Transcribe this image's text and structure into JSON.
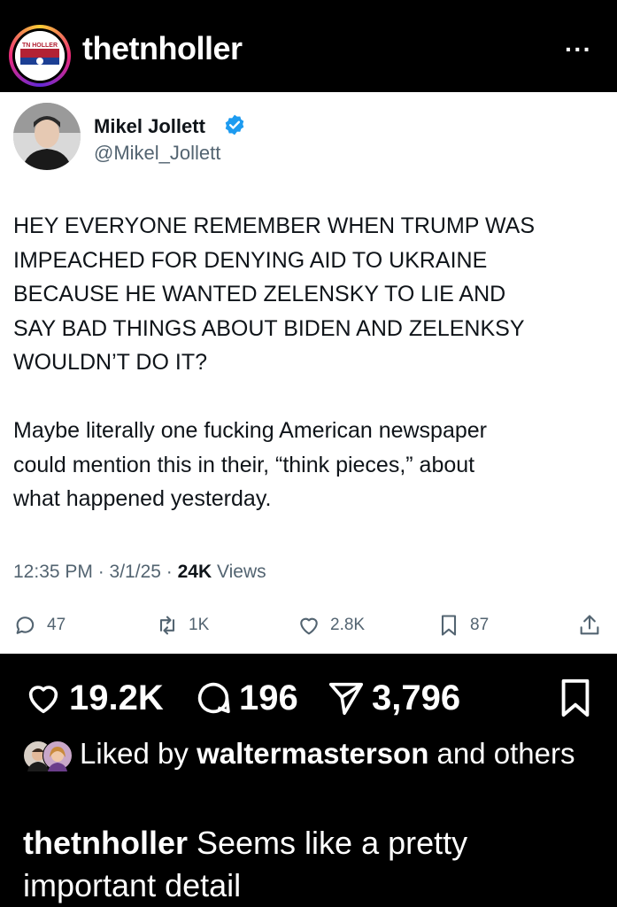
{
  "header": {
    "username": "thetnholler",
    "more_label": "···",
    "avatar_logo_text": "TN HOLLER"
  },
  "tweet": {
    "author_name": "Mikel Jollett",
    "author_handle": "@Mikel_Jollett",
    "verified": true,
    "body": "HEY EVERYONE REMEMBER WHEN TRUMP WAS\nIMPEACHED FOR DENYING AID TO UKRAINE\nBECAUSE HE WANTED ZELENSKY TO LIE AND\nSAY BAD THINGS ABOUT BIDEN AND ZELENKSY\nWOULDN’T DO IT?\n\nMaybe literally one fucking American newspaper\ncould mention this in their, “think pieces,” about\nwhat happened yesterday.",
    "time": "12:35 PM · 3/1/25 · ",
    "views_count": "24K",
    "views_label": " Views",
    "replies": "47",
    "retweets": "1K",
    "likes": "2.8K",
    "bookmarks": "87",
    "accent_color": "#1d9bf0"
  },
  "post": {
    "likes": "19.2K",
    "comments": "196",
    "shares": "3,796",
    "liked_by_prefix": "Liked by ",
    "liked_by_user": "waltermasterson",
    "liked_by_suffix": " and others",
    "caption_user": "thetnholler",
    "caption_text": " Seems like a pretty important detail"
  }
}
